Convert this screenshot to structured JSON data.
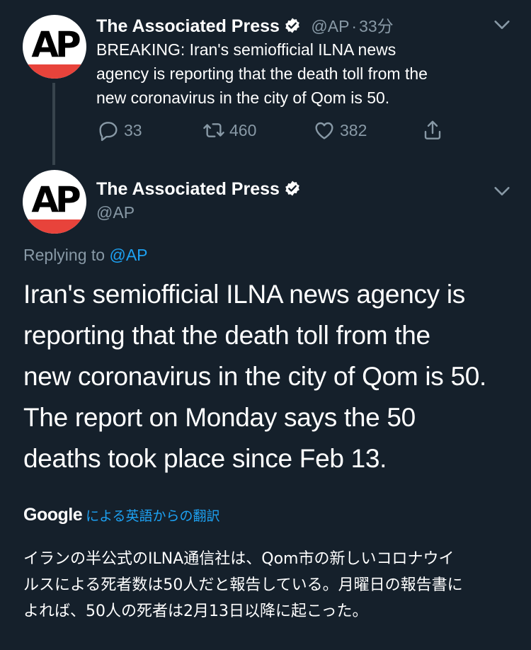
{
  "tweet1": {
    "avatar_text": "AP",
    "name": "The Associated Press",
    "handle": "@AP",
    "separator": "·",
    "time": "33分",
    "text_lines": [
      "BREAKING: Iran's semiofficial ILNA news",
      "agency is reporting that the death toll from the",
      "new coronavirus in the city of Qom is 50."
    ],
    "actions": {
      "replies": "33",
      "retweets": "460",
      "likes": "382"
    }
  },
  "tweet2": {
    "avatar_text": "AP",
    "name": "The Associated Press",
    "handle": "@AP",
    "replying_prefix": "Replying to",
    "replying_handle": "@AP",
    "text_lines": [
      "Iran's semiofficial ILNA news agency is",
      "reporting that the death toll from the",
      "new coronavirus in the city of Qom is 50.",
      "The report on Monday says the 50",
      "deaths took place since Feb 13."
    ]
  },
  "translation": {
    "brand": "Google",
    "link_text": "による英語からの翻訳",
    "text_lines": [
      "イランの半公式のILNA通信社は、Qom市の新しいコロナウイ",
      "ルスによる死者数は50人だと報告している。月曜日の報告書に",
      "よれば、50人の死者は2月13日以降に起こった。"
    ]
  },
  "colors": {
    "background": "#15202b",
    "secondary_text": "#8899a6",
    "accent": "#1da1f2",
    "ap_red": "#e8433b"
  },
  "icons": [
    "verified-badge-icon",
    "chevron-down-icon",
    "reply-icon",
    "retweet-icon",
    "like-icon",
    "share-icon"
  ]
}
